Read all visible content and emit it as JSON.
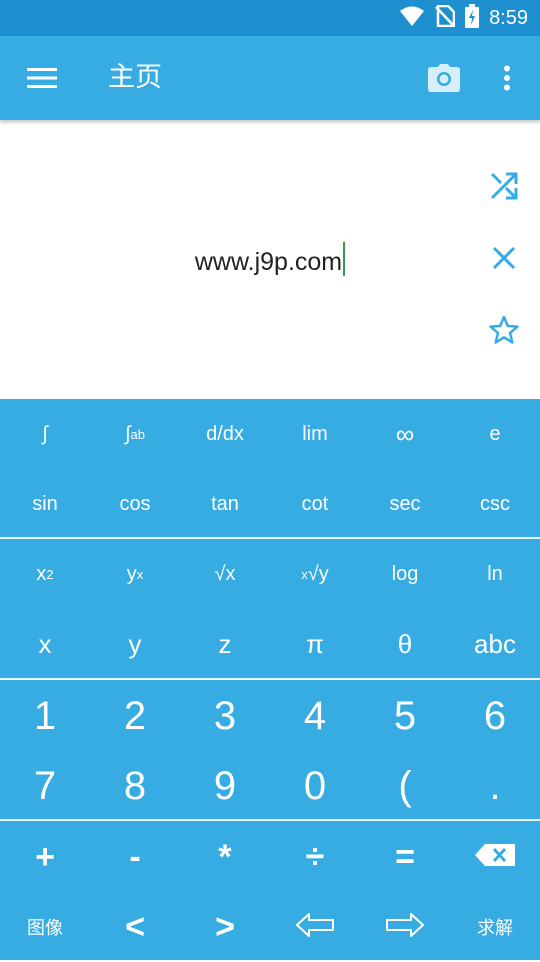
{
  "status_bar": {
    "time": "8:59",
    "icons": [
      "wifi-icon",
      "no-sim-icon",
      "battery-charging-icon"
    ]
  },
  "app_bar": {
    "title": "主页",
    "icons": [
      "hamburger-menu-icon",
      "camera-icon",
      "more-vert-icon"
    ]
  },
  "display": {
    "expression": "www.j9p.com",
    "side_icons": [
      "shuffle-icon",
      "clear-icon",
      "star-icon"
    ]
  },
  "colors": {
    "status_bar": "#1e8fcf",
    "app_bar": "#36ace3",
    "keyboard": "#36ace3",
    "caret": "#2e9a52",
    "side_icons": "#36ace3"
  },
  "keyboard": {
    "row1": {
      "k1": "∫",
      "k2_main": "∫",
      "k2_sub": "a",
      "k2_sup": "b",
      "k3": "d/dx",
      "k4": "lim",
      "k5": "∞",
      "k6": "e"
    },
    "row2": {
      "k1": "sin",
      "k2": "cos",
      "k3": "tan",
      "k4": "cot",
      "k5": "sec",
      "k6": "csc"
    },
    "row3": {
      "k1_base": "x",
      "k1_sup": "2",
      "k2_base": "y",
      "k2_sup": "x",
      "k3": "√x",
      "k4_sup": "x",
      "k4_base": "√y",
      "k5": "log",
      "k6": "ln"
    },
    "row4": {
      "k1": "x",
      "k2": "y",
      "k3": "z",
      "k4": "π",
      "k5": "θ",
      "k6": "abc"
    },
    "row5": {
      "k1": "1",
      "k2": "2",
      "k3": "3",
      "k4": "4",
      "k5": "5",
      "k6": "6"
    },
    "row6": {
      "k1": "7",
      "k2": "8",
      "k3": "9",
      "k4": "0",
      "k5": "(",
      "k6": "."
    },
    "row7": {
      "k1": "+",
      "k2": "-",
      "k3": "*",
      "k4": "÷",
      "k5": "=",
      "k6_icon": "backspace-icon"
    },
    "row8": {
      "k1": "图像",
      "k2": "<",
      "k3": ">",
      "k4_icon": "arrow-left-outline-icon",
      "k5_icon": "arrow-right-outline-icon",
      "k6": "求解"
    }
  }
}
